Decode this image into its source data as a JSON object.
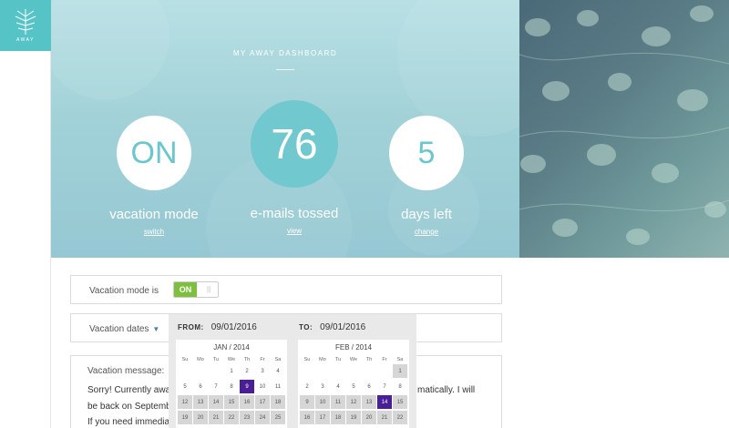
{
  "logo": {
    "text": "AWAY"
  },
  "hero": {
    "title": "MY AWAY DASHBOARD",
    "stats": [
      {
        "value": "ON",
        "label": "vacation mode",
        "link": "switch"
      },
      {
        "value": "76",
        "label": "e-mails tossed",
        "link": "view"
      },
      {
        "value": "5",
        "label": "days left",
        "link": "change"
      }
    ]
  },
  "form": {
    "vacation_mode_label": "Vacation mode is",
    "toggle_state": "ON",
    "dates_label": "Vacation dates",
    "dates_caret": "▼",
    "message_label": "Vacation message:",
    "message_lines": [
      "Sorry! Currently awa",
      "be back on Septemb",
      "If you need immedia"
    ],
    "message_right": [
      "matically. I will"
    ]
  },
  "picker": {
    "from_label": "FROM:",
    "from_value": "09/01/2016",
    "to_label": "TO:",
    "to_value": "09/01/2016",
    "weekdays": [
      "Su",
      "Mo",
      "Tu",
      "We",
      "Th",
      "Fr",
      "Sa"
    ],
    "months": [
      {
        "title": "JAN / 2014",
        "weeks": [
          [
            "",
            "",
            "",
            "1",
            "2",
            "3",
            "4"
          ],
          [
            "5",
            "6",
            "7",
            "8",
            "9",
            "10",
            "11"
          ],
          [
            "12",
            "13",
            "14",
            "15",
            "16",
            "17",
            "18"
          ],
          [
            "19",
            "20",
            "21",
            "22",
            "23",
            "24",
            "25"
          ]
        ],
        "selected": "9"
      },
      {
        "title": "FEB / 2014",
        "weeks": [
          [
            "",
            "",
            "",
            "",
            "",
            "",
            "1"
          ],
          [
            "2",
            "3",
            "4",
            "5",
            "6",
            "7",
            "8"
          ],
          [
            "9",
            "10",
            "11",
            "12",
            "13",
            "14",
            "15"
          ],
          [
            "16",
            "17",
            "18",
            "19",
            "20",
            "21",
            "22"
          ]
        ],
        "selected": "14"
      }
    ]
  },
  "colors": {
    "accent": "#56c4c7",
    "toggle_on": "#7fbf3f",
    "selected_day": "#4a1e95"
  }
}
